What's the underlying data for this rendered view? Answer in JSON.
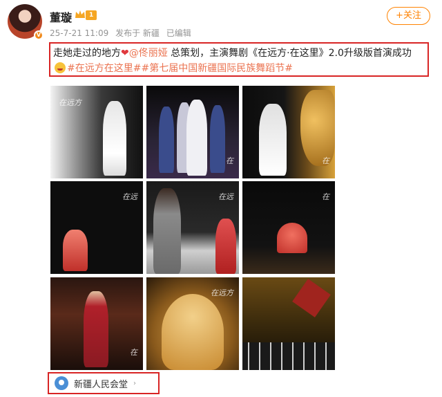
{
  "post": {
    "username": "董璇",
    "level_badge": "1",
    "timestamp": "25-7-21 11:09",
    "source": "发布于 新疆",
    "edited": "已编辑",
    "follow_label": "+关注",
    "text_part1": "走她走过的地方",
    "mention": "@佟丽娅",
    "text_part2": " 总策划，主演舞剧《在远方·在这里》2.0升级版首演成功",
    "hashtag1": "#在远方在这里#",
    "hashtag2": "#第七届中国新疆国际民族舞蹈节#",
    "location_label": "新疆人民会堂"
  },
  "icons": {
    "crown": "crown-icon",
    "heart": "heart-icon",
    "emoji": "smile-emoji-icon",
    "location": "location-pin-icon",
    "chevron": "chevron-right-icon"
  },
  "colors": {
    "accent": "#ff8200",
    "link": "#eb7350",
    "highlight_border": "#d82424",
    "location_pin": "#4a8fd6"
  },
  "photos": [
    {
      "name": "photo-white-dress-blur"
    },
    {
      "name": "photo-stage-group"
    },
    {
      "name": "photo-white-dress-golden"
    },
    {
      "name": "photo-red-dancer-1"
    },
    {
      "name": "photo-two-dancers"
    },
    {
      "name": "photo-red-dancer-spin"
    },
    {
      "name": "photo-red-dancer-arms"
    },
    {
      "name": "photo-golden-dancer"
    },
    {
      "name": "photo-ensemble-stage"
    }
  ]
}
